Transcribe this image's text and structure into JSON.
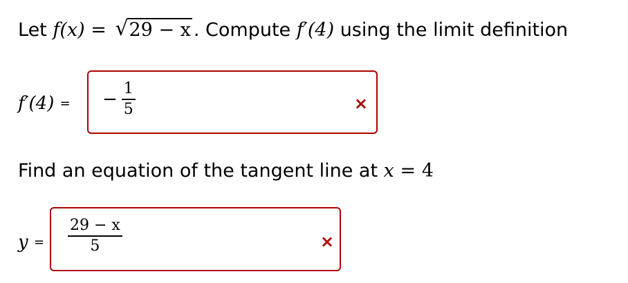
{
  "question1": {
    "prefix": "Let ",
    "func_def_lhs": "f(x)",
    "equals": "=",
    "radicand": "29 − x",
    "suffix_period": ".",
    "instruction": " Compute ",
    "derivative_expr": "f′(4)",
    "instruction_tail": " using the limit definition"
  },
  "answer1": {
    "label": "f′(4)",
    "equals": "=",
    "sign": "−",
    "numerator": "1",
    "denominator": "5",
    "status_mark": "×"
  },
  "question2": {
    "text": "Find an equation of the tangent line at ",
    "var": "x",
    "equals": "=",
    "value": "4"
  },
  "answer2": {
    "label": "y",
    "equals": "=",
    "numerator": "29 − x",
    "denominator": "5",
    "status_mark": "×"
  },
  "colors": {
    "incorrect": "#b00000",
    "text": "#000000",
    "background": "#ffffff"
  },
  "icons": {
    "status": "incorrect-x-icon"
  }
}
